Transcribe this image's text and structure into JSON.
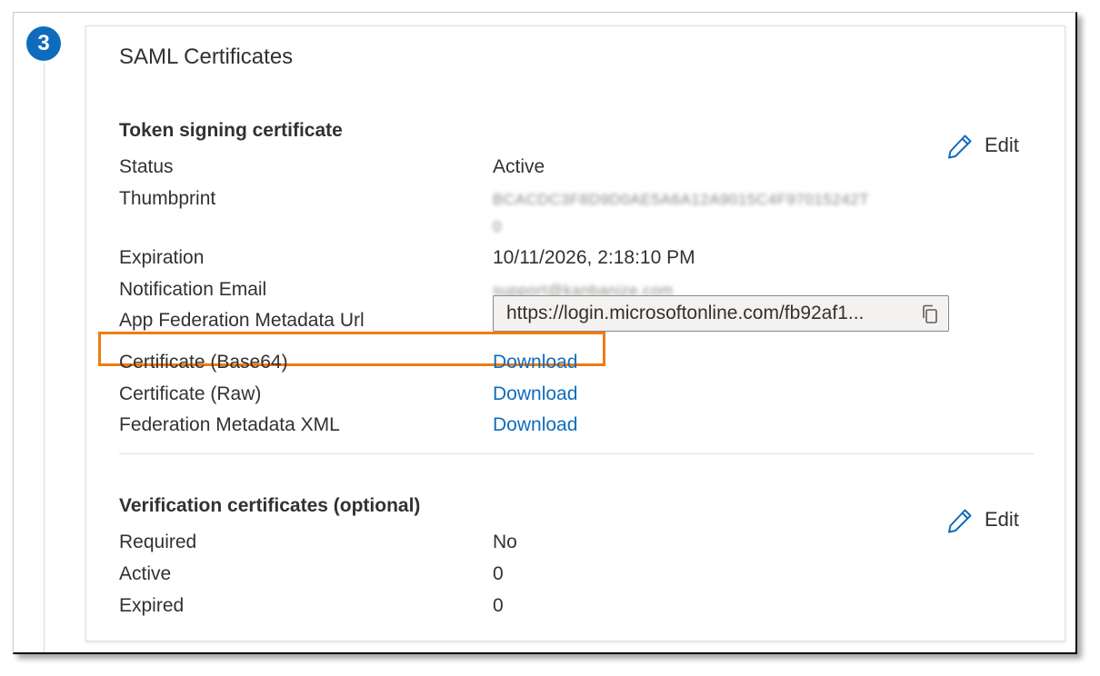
{
  "step": {
    "number": "3"
  },
  "card": {
    "title": "SAML Certificates"
  },
  "token_signing": {
    "title": "Token signing certificate",
    "edit_label": "Edit",
    "rows": {
      "status": {
        "label": "Status",
        "value": "Active"
      },
      "thumbprint": {
        "label": "Thumbprint",
        "value_line1": "BCACDC3F8D9D0AE5A6A12A9015C4F97015242T",
        "value_line2": "0"
      },
      "expiration": {
        "label": "Expiration",
        "value": "10/11/2026, 2:18:10 PM"
      },
      "notification_email": {
        "label": "Notification Email",
        "value": "support@kanbanize.com"
      },
      "metadata_url": {
        "label": "App Federation Metadata Url",
        "value": "https://login.microsoftonline.com/fb92af1..."
      },
      "cert_base64": {
        "label": "Certificate (Base64)",
        "link": "Download"
      },
      "cert_raw": {
        "label": "Certificate (Raw)",
        "link": "Download"
      },
      "federation_xml": {
        "label": "Federation Metadata XML",
        "link": "Download"
      }
    }
  },
  "verification": {
    "title": "Verification certificates (optional)",
    "edit_label": "Edit",
    "rows": {
      "required": {
        "label": "Required",
        "value": "No"
      },
      "active": {
        "label": "Active",
        "value": "0"
      },
      "expired": {
        "label": "Expired",
        "value": "0"
      }
    }
  },
  "colors": {
    "accent": "#0f6cbd",
    "highlight": "#ee7d10",
    "text": "#323130"
  },
  "icons": {
    "edit": "pencil-icon",
    "copy": "copy-icon"
  }
}
